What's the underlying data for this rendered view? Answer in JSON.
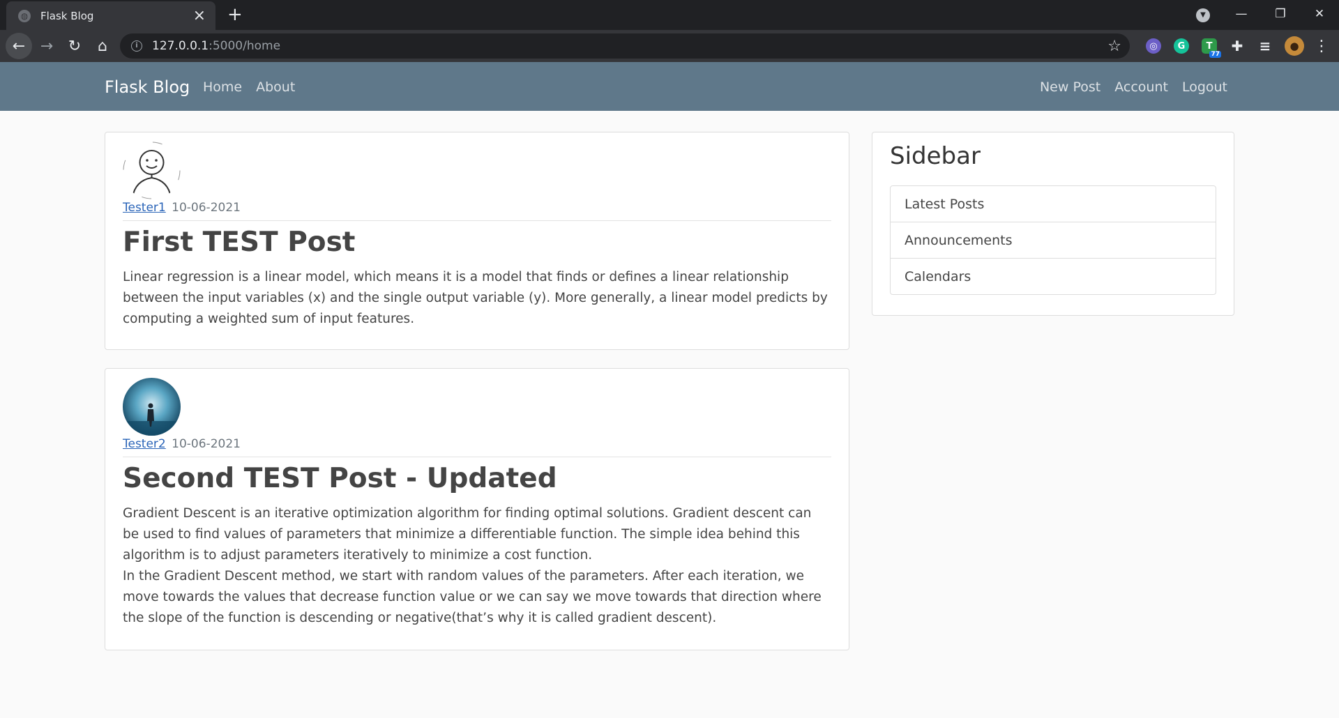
{
  "browser": {
    "tab_title": "Flask Blog",
    "url_host": "127.0.0.1",
    "url_path": ":5000/home",
    "extension_badge": "77"
  },
  "navbar": {
    "brand": "Flask Blog",
    "left_links": [
      "Home",
      "About"
    ],
    "right_links": [
      "New Post",
      "Account",
      "Logout"
    ]
  },
  "posts": [
    {
      "author": "Tester1",
      "date": "10-06-2021",
      "title": "First TEST Post",
      "paragraphs": [
        "Linear regression is a linear model, which means it is a model that finds or defines a linear relationship between the input variables (x) and the single output variable (y). More generally, a linear model predicts by computing a weighted sum of input features."
      ]
    },
    {
      "author": "Tester2",
      "date": "10-06-2021",
      "title": "Second TEST Post - Updated",
      "paragraphs": [
        "Gradient Descent is an iterative optimization algorithm for finding optimal solutions. Gradient descent can be used to find values of parameters that minimize a differentiable function. The simple idea behind this algorithm is to adjust parameters iteratively to minimize a cost function.",
        "In the Gradient Descent method, we start with random values of the parameters. After each iteration, we move towards the values that decrease function value or we can say we move towards that direction where the slope of the function is descending or negative(that’s why it is called gradient descent)."
      ]
    }
  ],
  "sidebar": {
    "title": "Sidebar",
    "items": [
      "Latest Posts",
      "Announcements",
      "Calendars"
    ]
  },
  "colors": {
    "navbar_bg": "#5f788a",
    "link": "#2a64b8",
    "page_bg": "#fafafa"
  }
}
